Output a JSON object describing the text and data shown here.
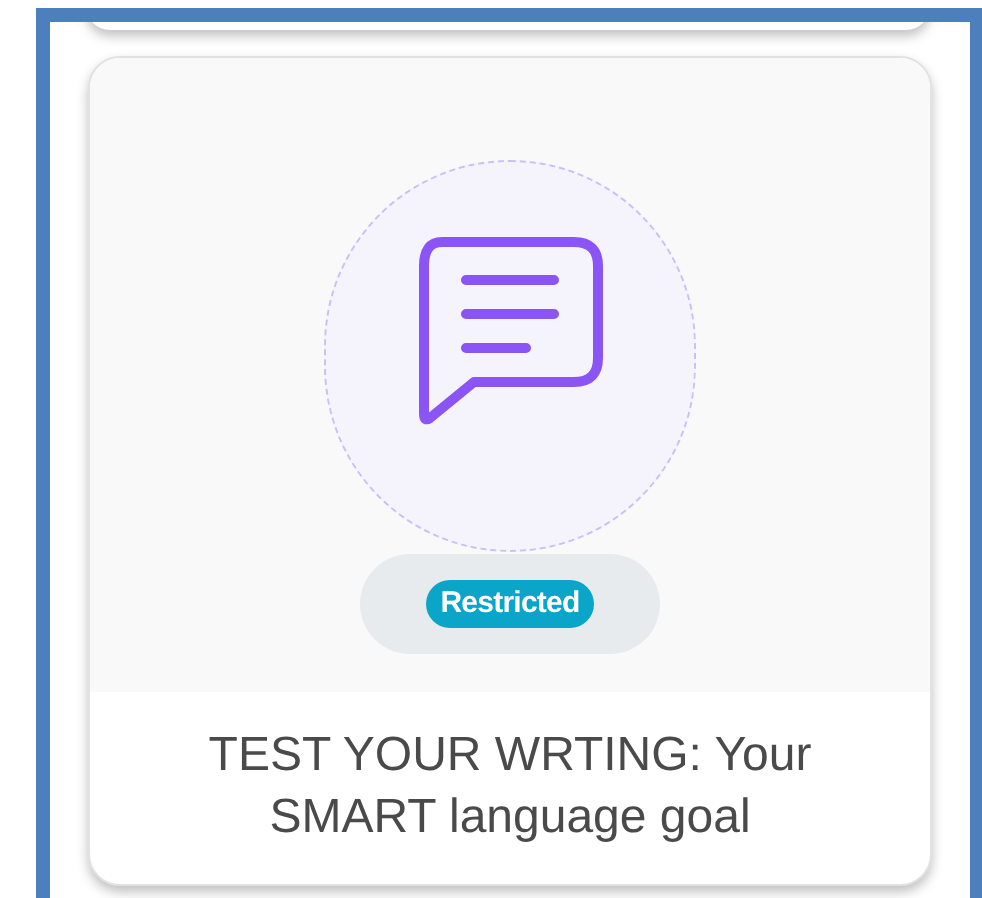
{
  "card": {
    "badge": "Restricted",
    "title": "TEST YOUR WRTING: Your SMART language goal"
  }
}
